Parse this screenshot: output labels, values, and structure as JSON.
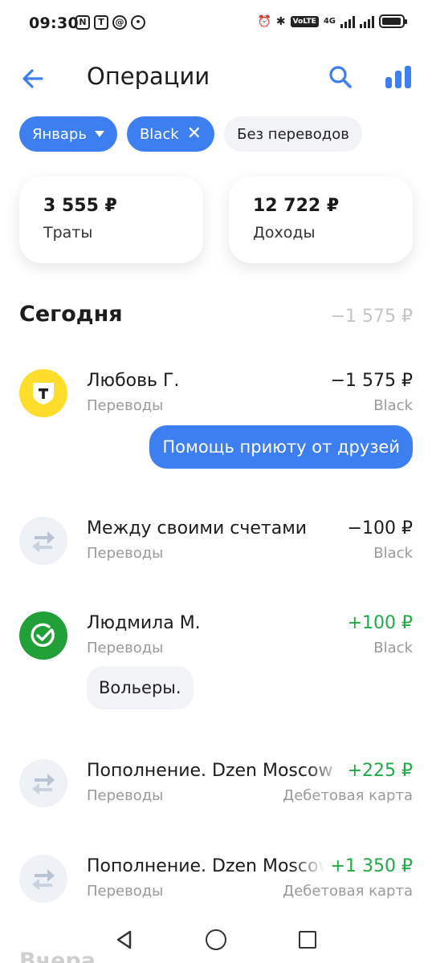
{
  "status_bar": {
    "time": "09:30",
    "left_icons": [
      "N",
      "T",
      "@",
      "•"
    ],
    "volte": "VoLTE",
    "network": "4G",
    "battery_level": 0.95
  },
  "header": {
    "title": "Операции",
    "back_icon": "arrow-left-icon",
    "search_icon": "search-icon",
    "stats_icon": "bar-chart-icon",
    "accent_color": "#3d7ff0"
  },
  "filters": {
    "month": "Январь",
    "card": "Black",
    "transfers": "Без переводов"
  },
  "summary": {
    "spending_amount": "3 555 ₽",
    "spending_label": "Траты",
    "income_amount": "12 722 ₽",
    "income_label": "Доходы"
  },
  "section": {
    "title": "Сегодня",
    "total": "−1 575 ₽",
    "next_title": "Вчера"
  },
  "operations": [
    {
      "name": "Любовь Г.",
      "category": "Переводы",
      "amount": "−1 575 ₽",
      "account": "Black",
      "icon": "tinkoff-logo-icon",
      "comment": "Помощь приюту от друзей"
    },
    {
      "name": "Между своими счетами",
      "category": "Переводы",
      "amount": "−100 ₽",
      "account": "Black",
      "icon": "transfer-arrows-icon"
    },
    {
      "name": "Людмила М.",
      "category": "Переводы",
      "amount": "+100 ₽",
      "account": "Black",
      "icon": "sber-logo-icon",
      "comment": "Вольеры."
    },
    {
      "name": "Пополнение. Dzen Moscow",
      "category": "Переводы",
      "amount": "+225 ₽",
      "account": "Дебетовая карта",
      "icon": "transfer-arrows-icon"
    },
    {
      "name": "Пополнение. Dzen Moscow",
      "category": "Переводы",
      "amount": "+1 350 ₽",
      "account": "Дебетовая карта",
      "icon": "transfer-arrows-icon"
    }
  ],
  "navbar": {
    "back": "nav-back-icon",
    "home": "nav-home-icon",
    "recent": "nav-recent-icon"
  }
}
